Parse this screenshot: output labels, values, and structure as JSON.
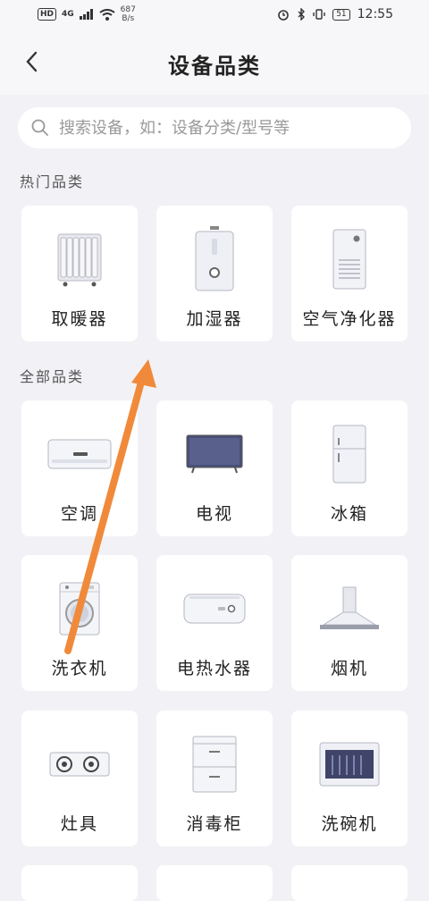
{
  "status_bar": {
    "hd": "HD",
    "signal": "4G",
    "speed_value": "687",
    "speed_unit": "B/s",
    "battery": "51",
    "time": "12:55",
    "icons": [
      "alarm-icon",
      "bluetooth-icon",
      "vibrate-icon",
      "battery-icon",
      "wifi-icon",
      "signal-icon"
    ]
  },
  "header": {
    "title": "设备品类",
    "back_icon": "chevron-left-icon"
  },
  "search": {
    "placeholder": "搜索设备，如：设备分类/型号等",
    "value": ""
  },
  "hot": {
    "title": "热门品类",
    "items": [
      {
        "label": "取暖器",
        "icon": "heater-icon"
      },
      {
        "label": "加湿器",
        "icon": "humidifier-icon"
      },
      {
        "label": "空气净化器",
        "icon": "air-purifier-icon"
      }
    ]
  },
  "all": {
    "title": "全部品类",
    "items": [
      {
        "label": "空调",
        "icon": "air-conditioner-icon"
      },
      {
        "label": "电视",
        "icon": "tv-icon"
      },
      {
        "label": "冰箱",
        "icon": "fridge-icon"
      },
      {
        "label": "洗衣机",
        "icon": "washing-machine-icon"
      },
      {
        "label": "电热水器",
        "icon": "water-heater-icon"
      },
      {
        "label": "烟机",
        "icon": "range-hood-icon"
      },
      {
        "label": "灶具",
        "icon": "stove-icon"
      },
      {
        "label": "消毒柜",
        "icon": "sterilizer-icon"
      },
      {
        "label": "洗碗机",
        "icon": "dishwasher-icon"
      }
    ]
  },
  "colors": {
    "background": "#f2f2f6",
    "card": "#ffffff",
    "arrow": "#f08a3a"
  }
}
